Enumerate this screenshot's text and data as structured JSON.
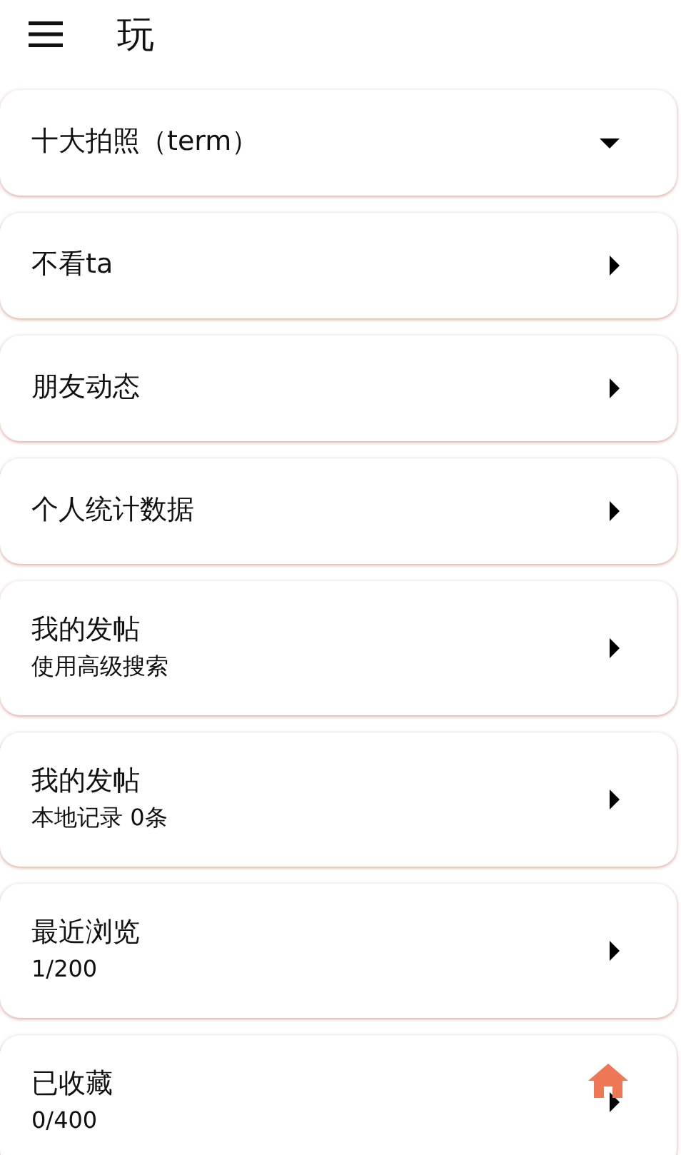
{
  "app_bar": {
    "title": "玩"
  },
  "items": [
    {
      "title": "十大拍照（term）",
      "expanded": true
    },
    {
      "title": "不看ta",
      "expanded": false
    },
    {
      "title": "朋友动态",
      "expanded": false
    },
    {
      "title": "个人统计数据",
      "expanded": false
    },
    {
      "title": "我的发帖",
      "subtitle": "使用高级搜索",
      "expanded": false
    },
    {
      "title": "我的发帖",
      "subtitle": "本地记录 0条",
      "expanded": false
    },
    {
      "title": "最近浏览",
      "subtitle": "1/200",
      "expanded": false
    },
    {
      "title": "已收藏",
      "subtitle": "0/400",
      "expanded": false
    }
  ]
}
